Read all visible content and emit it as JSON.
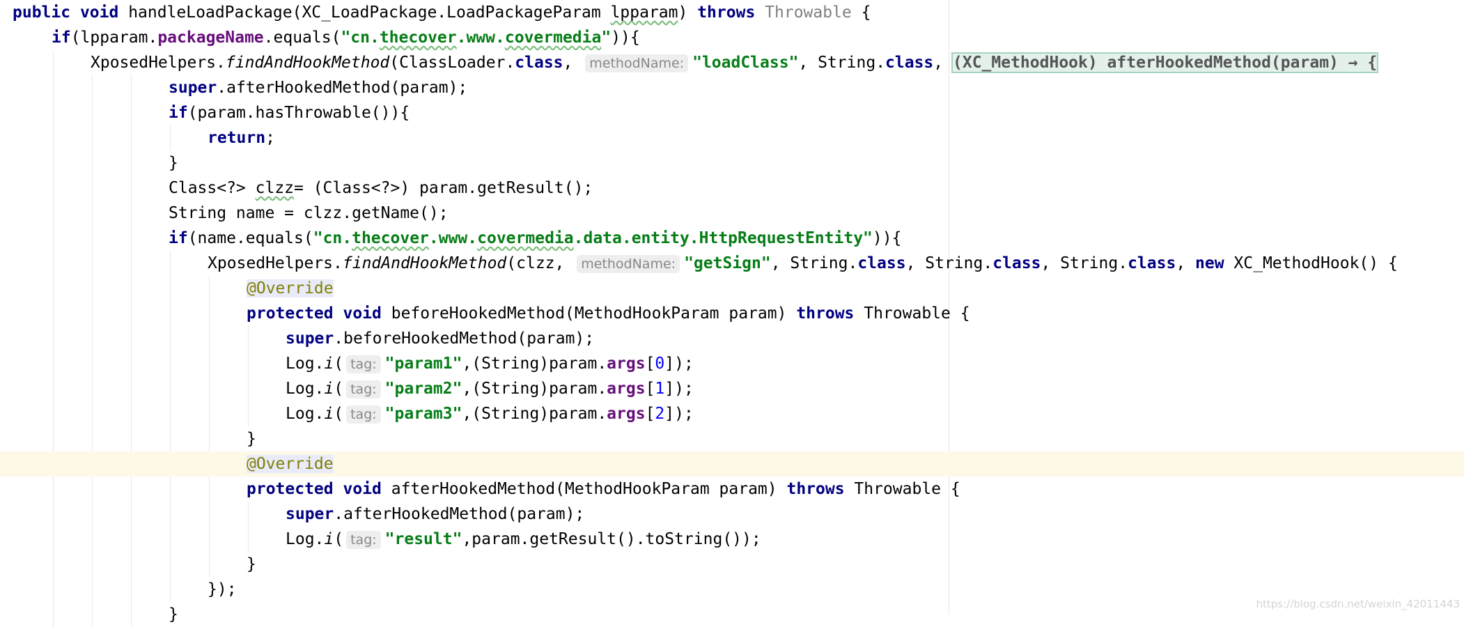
{
  "editor": {
    "lines": [
      {
        "indent": 0,
        "tokens": [
          {
            "t": "public",
            "c": "kw"
          },
          {
            "t": " "
          },
          {
            "t": "void",
            "c": "kw"
          },
          {
            "t": " handleLoadPackage(XC_LoadPackage.LoadPackageParam "
          },
          {
            "t": "lpparam",
            "c": "squig"
          },
          {
            "t": ") "
          },
          {
            "t": "throws",
            "c": "kw"
          },
          {
            "t": " "
          },
          {
            "t": "Throwable",
            "c": "gray"
          },
          {
            "t": " {"
          }
        ]
      },
      {
        "indent": 1,
        "tokens": [
          {
            "t": "if",
            "c": "kw"
          },
          {
            "t": "(lpparam."
          },
          {
            "t": "packageName",
            "c": "fld"
          },
          {
            "t": ".equals("
          },
          {
            "t": "\"cn.",
            "c": "str"
          },
          {
            "t": "thecover",
            "c": "str squig"
          },
          {
            "t": ".www.",
            "c": "str"
          },
          {
            "t": "covermedia",
            "c": "str squig"
          },
          {
            "t": "\"",
            "c": "str"
          },
          {
            "t": ")){"
          }
        ]
      },
      {
        "indent": 2,
        "tokens": [
          {
            "t": "XposedHelpers."
          },
          {
            "t": "findAndHookMethod",
            "c": "it"
          },
          {
            "t": "(ClassLoader."
          },
          {
            "t": "class",
            "c": "kw"
          },
          {
            "t": ", "
          },
          {
            "t": "methodName:",
            "c": "hint"
          },
          {
            "t": "\"loadClass\"",
            "c": "str"
          },
          {
            "t": ", String."
          },
          {
            "t": "class",
            "c": "kw"
          },
          {
            "t": ", "
          },
          {
            "t": "(XC_MethodHook) afterHookedMethod(param) → {",
            "c": "fold"
          }
        ]
      },
      {
        "indent": 4,
        "tokens": [
          {
            "t": "super",
            "c": "kw"
          },
          {
            "t": ".afterHookedMethod(param);"
          }
        ]
      },
      {
        "indent": 4,
        "tokens": [
          {
            "t": "if",
            "c": "kw"
          },
          {
            "t": "(param.hasThrowable()){"
          }
        ]
      },
      {
        "indent": 5,
        "tokens": [
          {
            "t": "return",
            "c": "kw"
          },
          {
            "t": ";"
          }
        ]
      },
      {
        "indent": 4,
        "tokens": [
          {
            "t": "}"
          }
        ]
      },
      {
        "indent": 4,
        "tokens": [
          {
            "t": "Class<?> "
          },
          {
            "t": "clzz",
            "c": "squig"
          },
          {
            "t": "= (Class<?>) param.getResult();"
          }
        ]
      },
      {
        "indent": 4,
        "tokens": [
          {
            "t": "String name = clzz.getName();"
          }
        ]
      },
      {
        "indent": 4,
        "tokens": [
          {
            "t": "if",
            "c": "kw"
          },
          {
            "t": "(name.equals("
          },
          {
            "t": "\"cn.",
            "c": "str"
          },
          {
            "t": "thecover",
            "c": "str squig"
          },
          {
            "t": ".www.",
            "c": "str"
          },
          {
            "t": "covermedia",
            "c": "str squig"
          },
          {
            "t": ".data.entity.HttpRequestEntity\"",
            "c": "str"
          },
          {
            "t": ")){"
          }
        ]
      },
      {
        "indent": 5,
        "tokens": [
          {
            "t": "XposedHelpers."
          },
          {
            "t": "findAndHookMethod",
            "c": "it"
          },
          {
            "t": "(clzz, "
          },
          {
            "t": "methodName:",
            "c": "hint"
          },
          {
            "t": "\"getSign\"",
            "c": "str"
          },
          {
            "t": ", String."
          },
          {
            "t": "class",
            "c": "kw"
          },
          {
            "t": ", String."
          },
          {
            "t": "class",
            "c": "kw"
          },
          {
            "t": ", String."
          },
          {
            "t": "class",
            "c": "kw"
          },
          {
            "t": ", "
          },
          {
            "t": "new",
            "c": "kw"
          },
          {
            "t": " XC_MethodHook() {"
          }
        ]
      },
      {
        "indent": 6,
        "tokens": [
          {
            "t": "@Override",
            "c": "ann"
          }
        ]
      },
      {
        "indent": 6,
        "tokens": [
          {
            "t": "protected",
            "c": "kw"
          },
          {
            "t": " "
          },
          {
            "t": "void",
            "c": "kw"
          },
          {
            "t": " beforeHookedMethod(MethodHookParam param) "
          },
          {
            "t": "throws",
            "c": "kw"
          },
          {
            "t": " Throwable {"
          }
        ]
      },
      {
        "indent": 7,
        "tokens": [
          {
            "t": "super",
            "c": "kw"
          },
          {
            "t": ".beforeHookedMethod(param);"
          }
        ]
      },
      {
        "indent": 7,
        "tokens": [
          {
            "t": "Log."
          },
          {
            "t": "i",
            "c": "it"
          },
          {
            "t": "("
          },
          {
            "t": "tag:",
            "c": "hint"
          },
          {
            "t": "\"param1\"",
            "c": "str"
          },
          {
            "t": ",(String)param."
          },
          {
            "t": "args",
            "c": "fld"
          },
          {
            "t": "["
          },
          {
            "t": "0",
            "c": "num"
          },
          {
            "t": "]);"
          }
        ]
      },
      {
        "indent": 7,
        "tokens": [
          {
            "t": "Log."
          },
          {
            "t": "i",
            "c": "it"
          },
          {
            "t": "("
          },
          {
            "t": "tag:",
            "c": "hint"
          },
          {
            "t": "\"param2\"",
            "c": "str"
          },
          {
            "t": ",(String)param."
          },
          {
            "t": "args",
            "c": "fld"
          },
          {
            "t": "["
          },
          {
            "t": "1",
            "c": "num"
          },
          {
            "t": "]);"
          }
        ]
      },
      {
        "indent": 7,
        "tokens": [
          {
            "t": "Log."
          },
          {
            "t": "i",
            "c": "it"
          },
          {
            "t": "("
          },
          {
            "t": "tag:",
            "c": "hint"
          },
          {
            "t": "\"param3\"",
            "c": "str"
          },
          {
            "t": ",(String)param."
          },
          {
            "t": "args",
            "c": "fld"
          },
          {
            "t": "["
          },
          {
            "t": "2",
            "c": "num"
          },
          {
            "t": "]);"
          }
        ]
      },
      {
        "indent": 6,
        "tokens": [
          {
            "t": "}"
          }
        ]
      },
      {
        "indent": 6,
        "current": true,
        "tokens": [
          {
            "t": "@Override",
            "c": "ann"
          }
        ]
      },
      {
        "indent": 6,
        "tokens": [
          {
            "t": "protected",
            "c": "kw"
          },
          {
            "t": " "
          },
          {
            "t": "void",
            "c": "kw"
          },
          {
            "t": " afterHookedMethod(MethodHookParam param) "
          },
          {
            "t": "throws",
            "c": "kw"
          },
          {
            "t": " Throwable {"
          }
        ]
      },
      {
        "indent": 7,
        "tokens": [
          {
            "t": "super",
            "c": "kw"
          },
          {
            "t": ".afterHookedMethod(param);"
          }
        ]
      },
      {
        "indent": 7,
        "tokens": [
          {
            "t": "Log."
          },
          {
            "t": "i",
            "c": "it"
          },
          {
            "t": "("
          },
          {
            "t": "tag:",
            "c": "hint"
          },
          {
            "t": "\"result\"",
            "c": "str"
          },
          {
            "t": ",param.getResult().toString());"
          }
        ]
      },
      {
        "indent": 6,
        "tokens": [
          {
            "t": "}"
          }
        ]
      },
      {
        "indent": 5,
        "tokens": [
          {
            "t": "});"
          }
        ]
      },
      {
        "indent": 4,
        "tokens": [
          {
            "t": "}"
          }
        ]
      }
    ]
  },
  "watermark": "https://blog.csdn.net/weixin_42011443"
}
